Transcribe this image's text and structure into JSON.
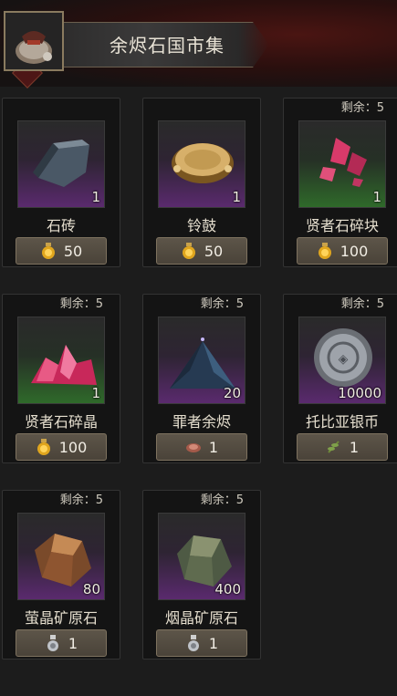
{
  "header": {
    "title": "余烬石国市集",
    "bag_icon": "loot-bag-icon"
  },
  "items": [
    {
      "name": "石砖",
      "quantity": "1",
      "remaining": null,
      "background": "purple",
      "icon": "stone-brick-icon",
      "price": "50",
      "currency_icon": "gold-potion-icon"
    },
    {
      "name": "铃鼓",
      "quantity": "1",
      "remaining": null,
      "background": "purple",
      "icon": "tambourine-icon",
      "price": "50",
      "currency_icon": "gold-potion-icon"
    },
    {
      "name": "贤者石碎块",
      "quantity": "1",
      "remaining": "剩余：5",
      "background": "green",
      "icon": "philosopher-stone-fragment-icon",
      "price": "100",
      "currency_icon": "gold-potion-icon"
    },
    {
      "name": "贤者石碎晶",
      "quantity": "1",
      "remaining": "剩余：5",
      "background": "green",
      "icon": "philosopher-stone-crystal-icon",
      "price": "100",
      "currency_icon": "gold-potion-icon"
    },
    {
      "name": "罪者余烬",
      "quantity": "20",
      "remaining": "剩余：5",
      "background": "purple",
      "icon": "sinner-ember-icon",
      "price": "1",
      "currency_icon": "meat-icon"
    },
    {
      "name": "托比亚银币",
      "quantity": "10000",
      "remaining": "剩余：5",
      "background": "purple",
      "icon": "silver-coin-icon",
      "price": "1",
      "currency_icon": "herb-icon"
    },
    {
      "name": "萤晶矿原石",
      "quantity": "80",
      "remaining": "剩余：5",
      "background": "purple",
      "icon": "firefly-ore-icon",
      "price": "1",
      "currency_icon": "silver-flask-icon"
    },
    {
      "name": "烟晶矿原石",
      "quantity": "400",
      "remaining": "剩余：5",
      "background": "purple",
      "icon": "smoke-ore-icon",
      "price": "1",
      "currency_icon": "silver-flask-icon"
    }
  ]
}
